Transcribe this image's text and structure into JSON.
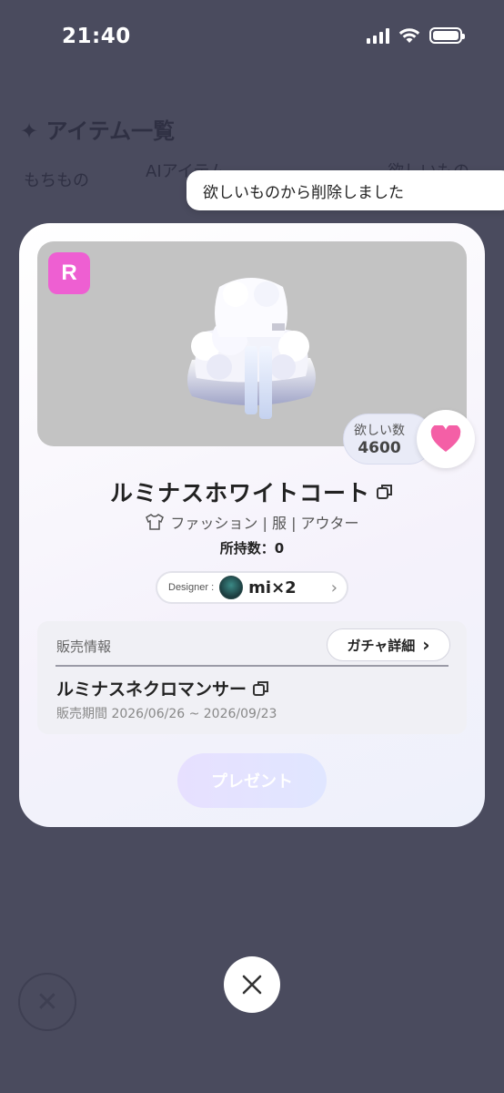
{
  "status_bar": {
    "time": "21:40"
  },
  "background": {
    "title": "✦ アイテム一覧",
    "tabs": [
      "もちもの",
      "AIアイテム",
      "欲しいもの"
    ]
  },
  "toast": {
    "message": "欲しいものから削除しました"
  },
  "item": {
    "rarity": "R",
    "name": "ルミナスホワイトコート",
    "category": "ファッション | 服 | アウター",
    "owned": "所持数：0",
    "wish_label": "欲しい数",
    "wish_count": "4600"
  },
  "designer": {
    "label": "Designer :",
    "name": "mi×2"
  },
  "sale": {
    "label": "販売情報",
    "gacha_button": "ガチャ詳細",
    "gacha_name": "ルミナスネクロマンサー",
    "period": "販売期間 2026/06/26 ~ 2026/09/23"
  },
  "actions": {
    "present": "プレゼント"
  },
  "colors": {
    "rarity": "#ee5fd2",
    "heart": "#f45fa6",
    "overlay": "#4a4b5e"
  }
}
